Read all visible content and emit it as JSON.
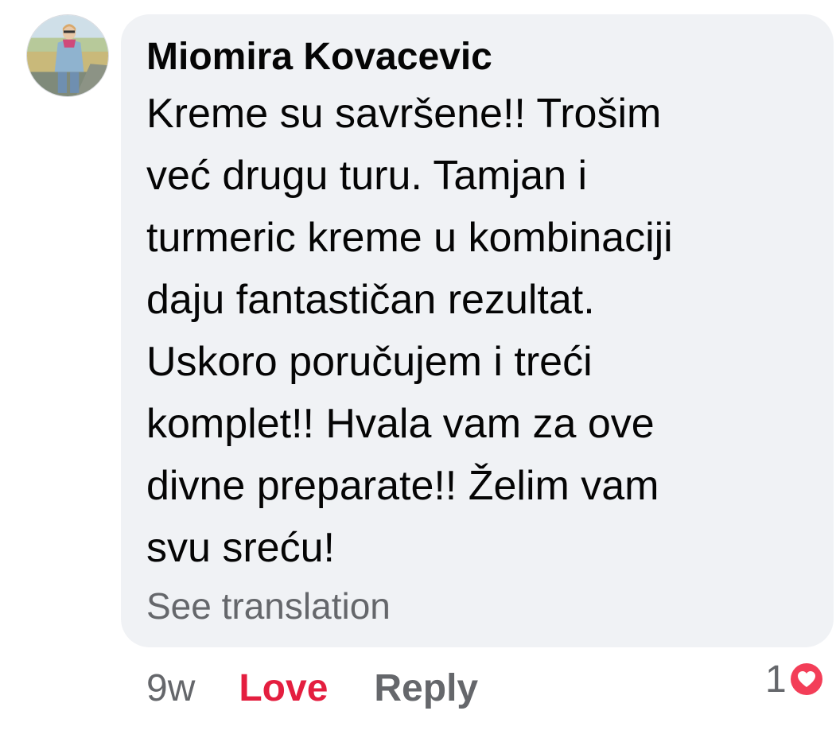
{
  "comment": {
    "author": "Miomira Kovacevic",
    "text_lines": [
      "Kreme su savršene!! Trošim",
      "već drugu turu. Tamjan i",
      "turmeric kreme u kombinaciji",
      "daju fantastičan rezultat.",
      "Uskoro poručujem i treći",
      "komplet!! Hvala vam za ove",
      "divne preparate!! Želim vam",
      "svu sreću!"
    ],
    "see_translation": "See translation",
    "avatar_icon": "profile-photo"
  },
  "actions": {
    "time": "9w",
    "love_label": "Love",
    "reply_label": "Reply"
  },
  "reactions": {
    "count": "1",
    "icon": "heart-icon"
  },
  "colors": {
    "bubble_bg": "#f0f2f5",
    "text": "#050505",
    "secondary": "#65676b",
    "love": "#e41e3f"
  }
}
